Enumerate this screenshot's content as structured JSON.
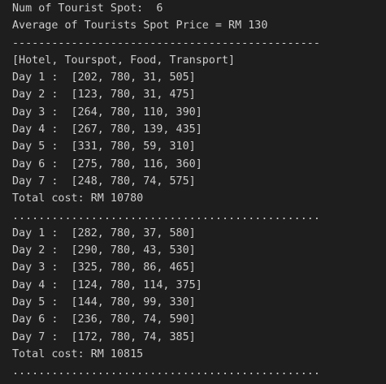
{
  "terminal": {
    "lines": [
      "Num of Tourist Spot:  6",
      "Average of Tourists Spot Price = RM 130",
      "-----------------------------------------------",
      "[Hotel, Tourspot, Food, Transport]",
      "Day 1 :  [202, 780, 31, 505]",
      "Day 2 :  [123, 780, 31, 475]",
      "Day 3 :  [264, 780, 110, 390]",
      "Day 4 :  [267, 780, 139, 435]",
      "Day 5 :  [331, 780, 59, 310]",
      "Day 6 :  [275, 780, 116, 360]",
      "Day 7 :  [248, 780, 74, 575]",
      "Total cost: RM 10780",
      "...............................................",
      "Day 1 :  [282, 780, 37, 580]",
      "Day 2 :  [290, 780, 43, 530]",
      "Day 3 :  [325, 780, 86, 465]",
      "Day 4 :  [124, 780, 114, 375]",
      "Day 5 :  [144, 780, 99, 330]",
      "Day 6 :  [236, 780, 74, 590]",
      "Day 7 :  [172, 780, 74, 385]",
      "Total cost: RM 10815",
      "..............................................."
    ]
  }
}
